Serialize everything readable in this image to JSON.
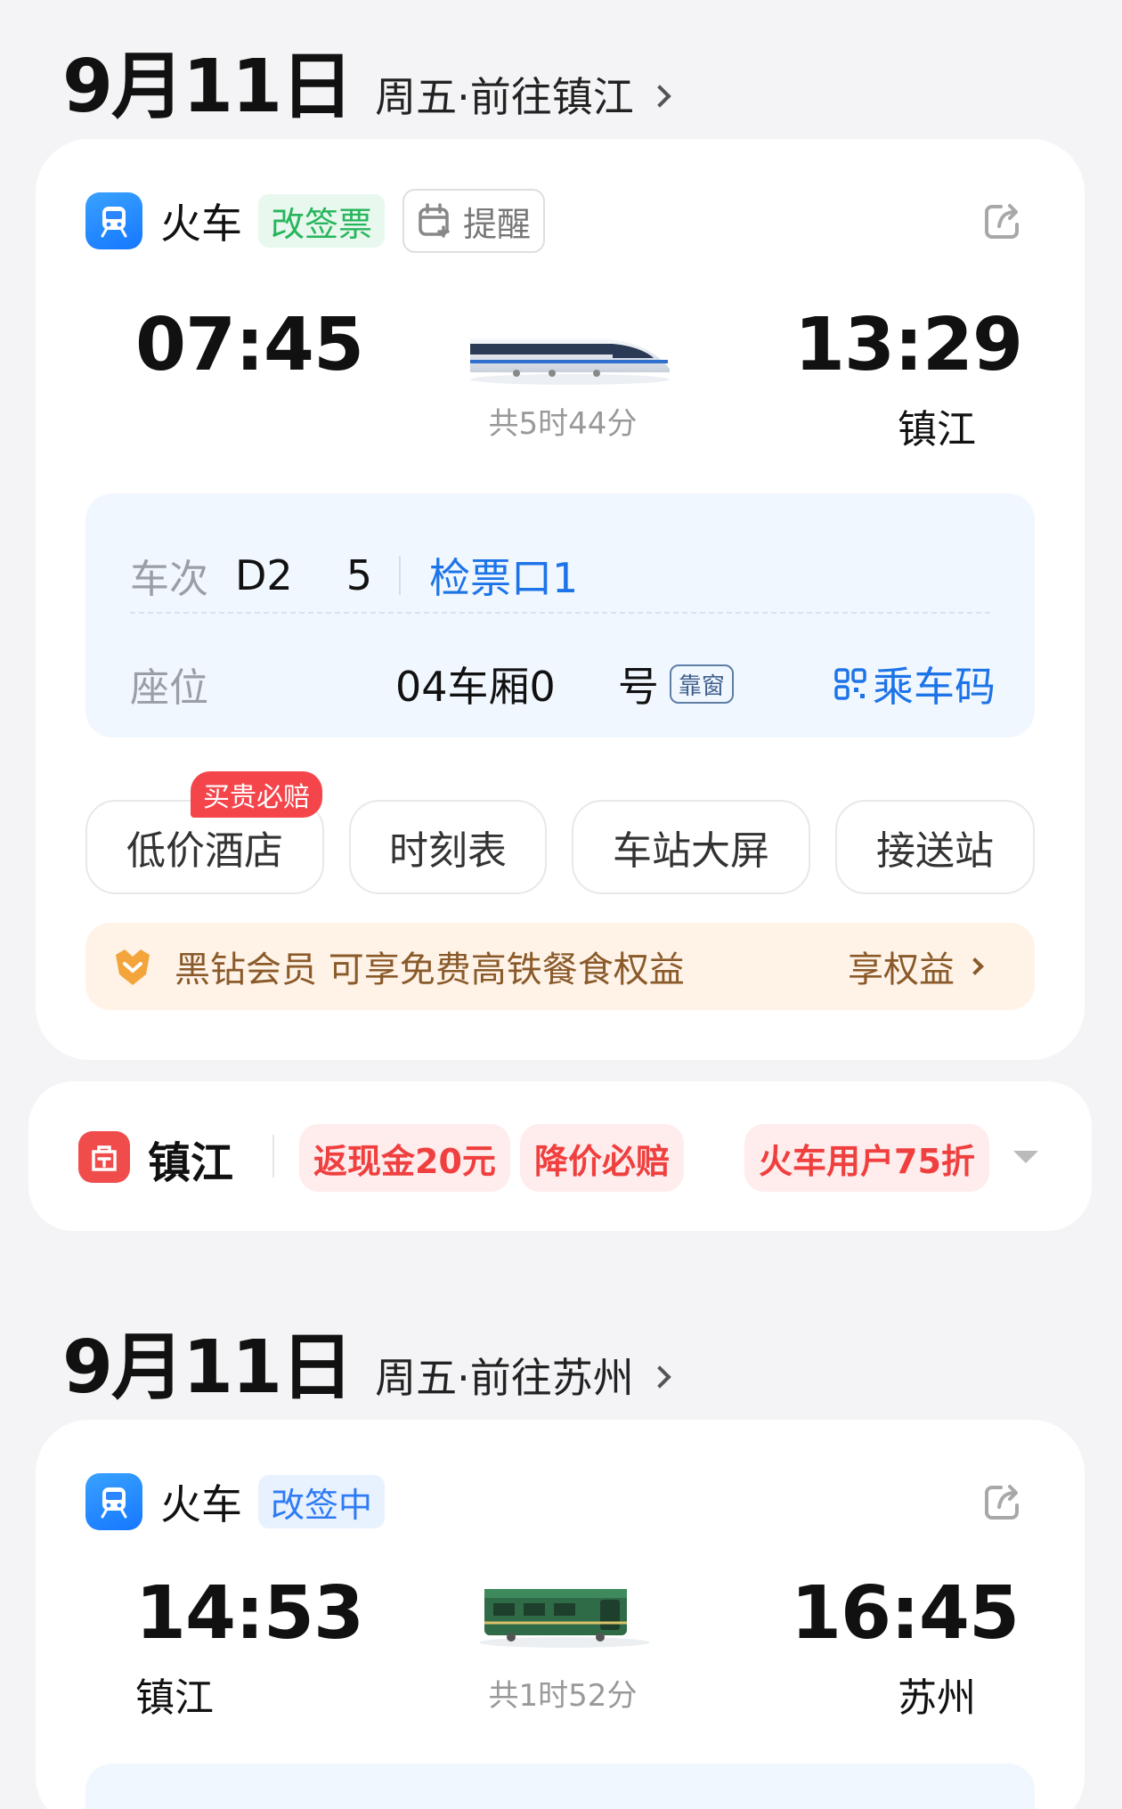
{
  "trip1": {
    "date": "9月11日",
    "subtitle": "周五·前往镇江",
    "type_label": "火车",
    "status_tag": "改签票",
    "remind_label": "提醒",
    "depart_time": "07:45",
    "arrive_time": "13:29",
    "arrive_station": "镇江",
    "duration": "共5时44分",
    "train_no_label": "车次",
    "train_no": "D2",
    "train_no_suffix": "5",
    "gate_label": "检票口1",
    "seat_label": "座位",
    "seat_value": "04车厢0",
    "seat_suffix": "号",
    "window_tag": "靠窗",
    "ride_code": "乘车码",
    "actions": {
      "hotel": "低价酒店",
      "timetable": "时刻表",
      "station_screen": "车站大屏",
      "transfer": "接送站"
    },
    "hotel_badge": "买贵必赔",
    "promo_text": "黑钻会员 可享免费高铁餐食权益",
    "promo_link": "享权益"
  },
  "hotel_strip": {
    "city": "镇江",
    "tags": [
      "返现金20元",
      "降价必赔",
      "火车用户75折"
    ]
  },
  "trip2": {
    "date": "9月11日",
    "subtitle": "周五·前往苏州",
    "type_label": "火车",
    "status_tag": "改签中",
    "depart_time": "14:53",
    "depart_station": "镇江",
    "arrive_time": "16:45",
    "arrive_station": "苏州",
    "duration": "共1时52分"
  },
  "colors": {
    "accent_blue": "#1d74e8",
    "green_tag": "#27b55c",
    "promo_brown": "#8a5a2a",
    "red_tag": "#ef3f3f"
  }
}
